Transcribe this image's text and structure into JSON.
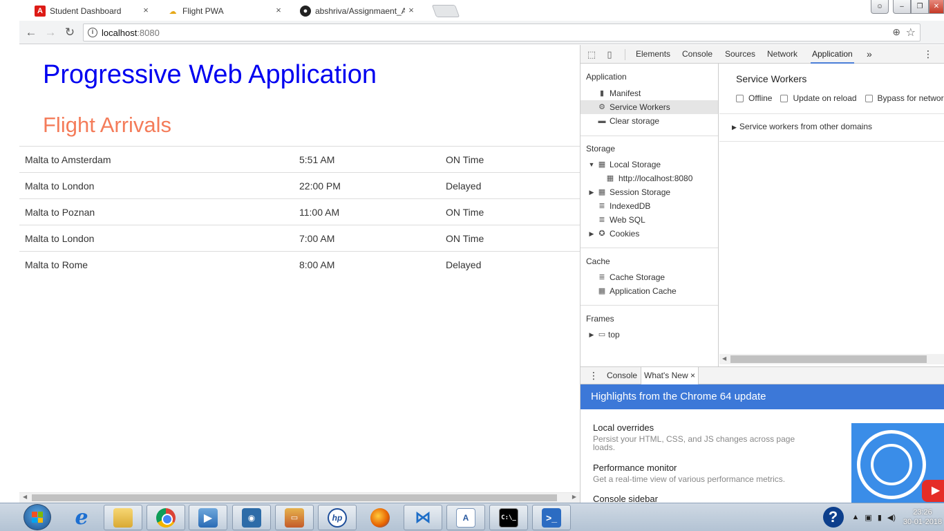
{
  "browser": {
    "tabs": [
      {
        "label": "Student Dashboard",
        "icon": "angular-icon",
        "active": false
      },
      {
        "label": "Flight PWA",
        "icon": "cloud-icon",
        "active": true
      },
      {
        "label": "abshriva/Assignmaent_A",
        "icon": "github-icon",
        "active": false
      }
    ],
    "tab_close_glyph": "×",
    "address": {
      "host": "localhost",
      "port": ":8080"
    },
    "info_glyph": "i"
  },
  "page": {
    "title": "Progressive Web Application",
    "subtitle": "Flight Arrivals",
    "flights": [
      {
        "route": "Malta to Amsterdam",
        "time": "5:51 AM",
        "status": "ON Time"
      },
      {
        "route": "Malta to London",
        "time": "22:00 PM",
        "status": "Delayed"
      },
      {
        "route": "Malta to Poznan",
        "time": "11:00 AM",
        "status": "ON Time"
      },
      {
        "route": "Malta to London",
        "time": "7:00 AM",
        "status": "ON Time"
      },
      {
        "route": "Malta to Rome",
        "time": "8:00 AM",
        "status": "Delayed"
      }
    ],
    "colors": {
      "title": "#0000f0",
      "subtitle": "#f47c5a"
    }
  },
  "devtools": {
    "tabs": [
      "Elements",
      "Console",
      "Sources",
      "Network",
      "Application"
    ],
    "active_tab": "Application",
    "more_glyph": "»",
    "sidebar": {
      "application_header": "Application",
      "application_items": [
        "Manifest",
        "Service Workers",
        "Clear storage"
      ],
      "storage_header": "Storage",
      "local_storage": "Local Storage",
      "local_storage_origin": "http://localhost:8080",
      "session_storage": "Session Storage",
      "indexeddb": "IndexedDB",
      "websql": "Web SQL",
      "cookies": "Cookies",
      "cache_header": "Cache",
      "cache_storage": "Cache Storage",
      "app_cache": "Application Cache",
      "frames_header": "Frames",
      "frame_top": "top"
    },
    "service_workers": {
      "heading": "Service Workers",
      "options": [
        "Offline",
        "Update on reload",
        "Bypass for network"
      ],
      "other_domains": "Service workers from other domains"
    },
    "drawer": {
      "tabs": [
        "Console",
        "What's New"
      ],
      "close_glyph": "×",
      "banner": "Highlights from the Chrome 64 update",
      "items": [
        {
          "title": "Local overrides",
          "desc": "Persist your HTML, CSS, and JS changes across page loads."
        },
        {
          "title": "Performance monitor",
          "desc": "Get a real-time view of various performance metrics."
        },
        {
          "title": "Console sidebar",
          "desc": ""
        }
      ],
      "accent": "#3c78d8"
    }
  },
  "taskbar": {
    "apps": [
      "internet-explorer",
      "file-explorer",
      "chrome",
      "media-player",
      "eye-app",
      "pc-app",
      "hp-app",
      "firefox",
      "visual-studio-code",
      "document-app",
      "command-prompt",
      "powershell"
    ],
    "clock_time": "23:26",
    "clock_date": "30-01-2018"
  }
}
